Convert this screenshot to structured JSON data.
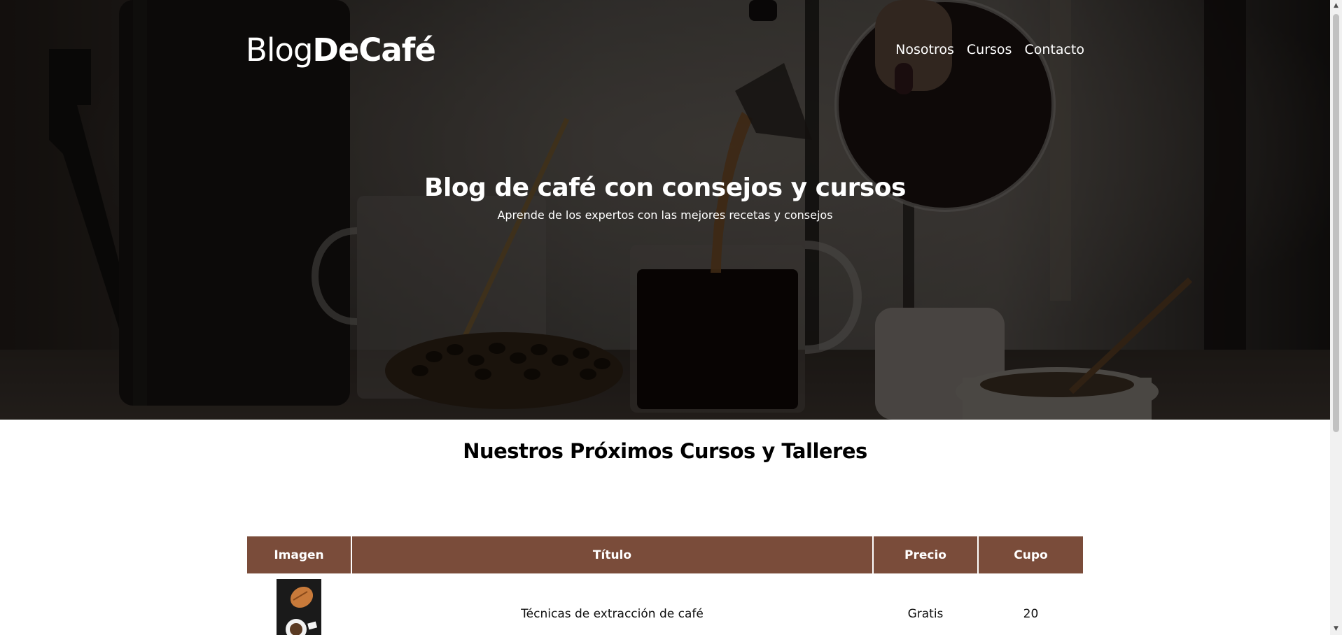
{
  "header": {
    "logo_light": "Blog",
    "logo_bold": "DeCafé",
    "nav": [
      {
        "label": "Nosotros"
      },
      {
        "label": "Cursos"
      },
      {
        "label": "Contacto"
      }
    ]
  },
  "hero": {
    "title": "Blog de café con consejos y cursos",
    "subtitle": "Aprende de los expertos con las mejores recetas y consejos"
  },
  "courses": {
    "title": "Nuestros Próximos Cursos y Talleres",
    "columns": [
      "Imagen",
      "Título",
      "Precio",
      "Cupo"
    ],
    "rows": [
      {
        "titulo": "Técnicas de extracción de café",
        "precio": "Gratis",
        "cupo": "20"
      }
    ]
  },
  "colors": {
    "table_header": "#7a4c3a",
    "hero_overlay": "#000000"
  },
  "icons": {
    "scroll_up": "chevron-up-icon",
    "scroll_down": "chevron-down-icon"
  }
}
